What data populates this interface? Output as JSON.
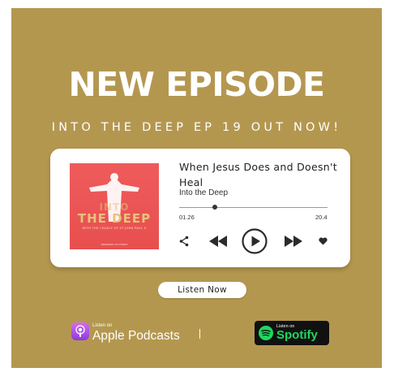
{
  "poster": {
    "background": "#b4974f",
    "headline": "NEW EPISODE",
    "subline": "INTO THE DEEP EP 19 OUT NOW!"
  },
  "player": {
    "artwork": {
      "title_line1": "INTO",
      "title_line2": "THE DEEP",
      "caption": "WITH THE LEGACY OF ST JOHN PAUL II",
      "footer": "SERVANTS OF CHRIST"
    },
    "episode_title": "When Jesus Does and Doesn't Heal",
    "show_name": "Into the Deep",
    "progress": 0.24,
    "current_time": "01.26",
    "duration": "20.4",
    "controls": [
      "share-icon",
      "rewind-icon",
      "play-icon",
      "fast-forward-icon",
      "heart-icon"
    ]
  },
  "cta": {
    "listen_now_label": "Listen Now"
  },
  "badges": {
    "apple": {
      "small": "Listen on",
      "big": "Apple Podcasts",
      "accent": "#b150e2"
    },
    "spotify": {
      "small": "Listen on",
      "big": "Spotify",
      "accent": "#1ed760"
    }
  }
}
